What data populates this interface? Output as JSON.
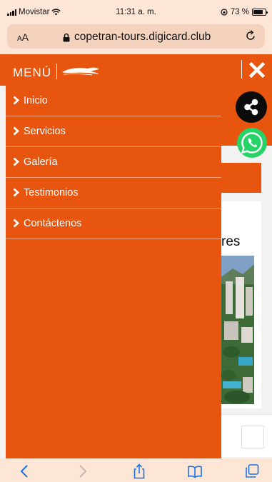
{
  "status_bar": {
    "carrier": "Movistar",
    "time": "11:31 a. m.",
    "battery_text": "73 %",
    "battery_level_percent": 73,
    "icons": [
      "signal-icon",
      "wifi-icon",
      "orientation-lock-icon",
      "battery-icon"
    ]
  },
  "browser": {
    "text_size_label_small": "A",
    "text_size_label_large": "A",
    "url": "copetran-tours.digicard.club",
    "icons": [
      "lock-icon",
      "reload-icon"
    ]
  },
  "menu": {
    "title": "MENÚ",
    "items": [
      {
        "label": "Inicio"
      },
      {
        "label": "Servicios"
      },
      {
        "label": "Galería"
      },
      {
        "label": "Testimonios"
      },
      {
        "label": "Contáctenos"
      }
    ],
    "icons": [
      "logo-icon",
      "close-icon",
      "chevron-right-icon"
    ]
  },
  "page_behind": {
    "partial_heading": "res",
    "icons": [
      "share-icon",
      "whatsapp-icon"
    ]
  },
  "toolbar": {
    "icons": [
      "back-icon",
      "forward-icon",
      "share-icon",
      "bookmarks-icon",
      "tabs-icon"
    ]
  },
  "colors": {
    "brand_orange": "#e8550f",
    "browser_chrome": "#fde6d6",
    "whatsapp_green": "#25d366",
    "ios_blue": "#1a73e8"
  }
}
